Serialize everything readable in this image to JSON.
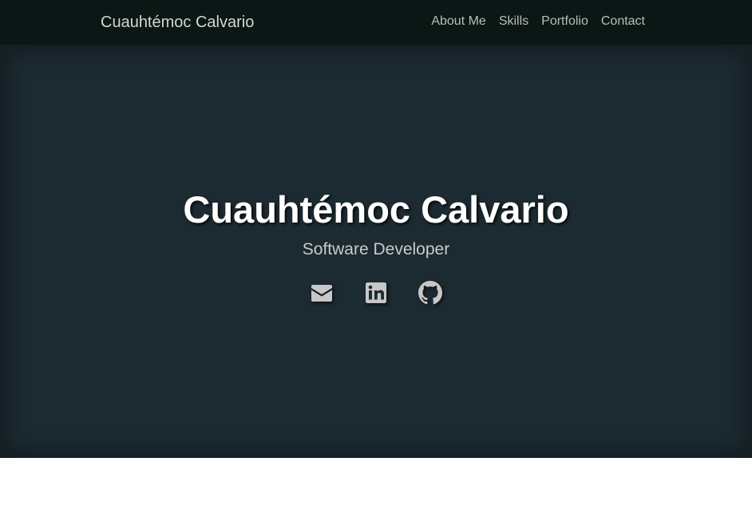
{
  "navbar": {
    "brand": "Cuauhtémoc Calvario",
    "links": [
      {
        "label": "About Me"
      },
      {
        "label": "Skills"
      },
      {
        "label": "Portfolio"
      },
      {
        "label": "Contact"
      }
    ]
  },
  "hero": {
    "title": "Cuauhtémoc Calvario",
    "subtitle": "Software Developer",
    "social_icons": [
      "envelope-icon",
      "linkedin-icon",
      "github-icon"
    ]
  },
  "colors": {
    "navbar_bg": "#0b1714",
    "hero_bg": "#1c2a31",
    "hero_title": "#ffffff",
    "icon": "#c7c7c7"
  }
}
